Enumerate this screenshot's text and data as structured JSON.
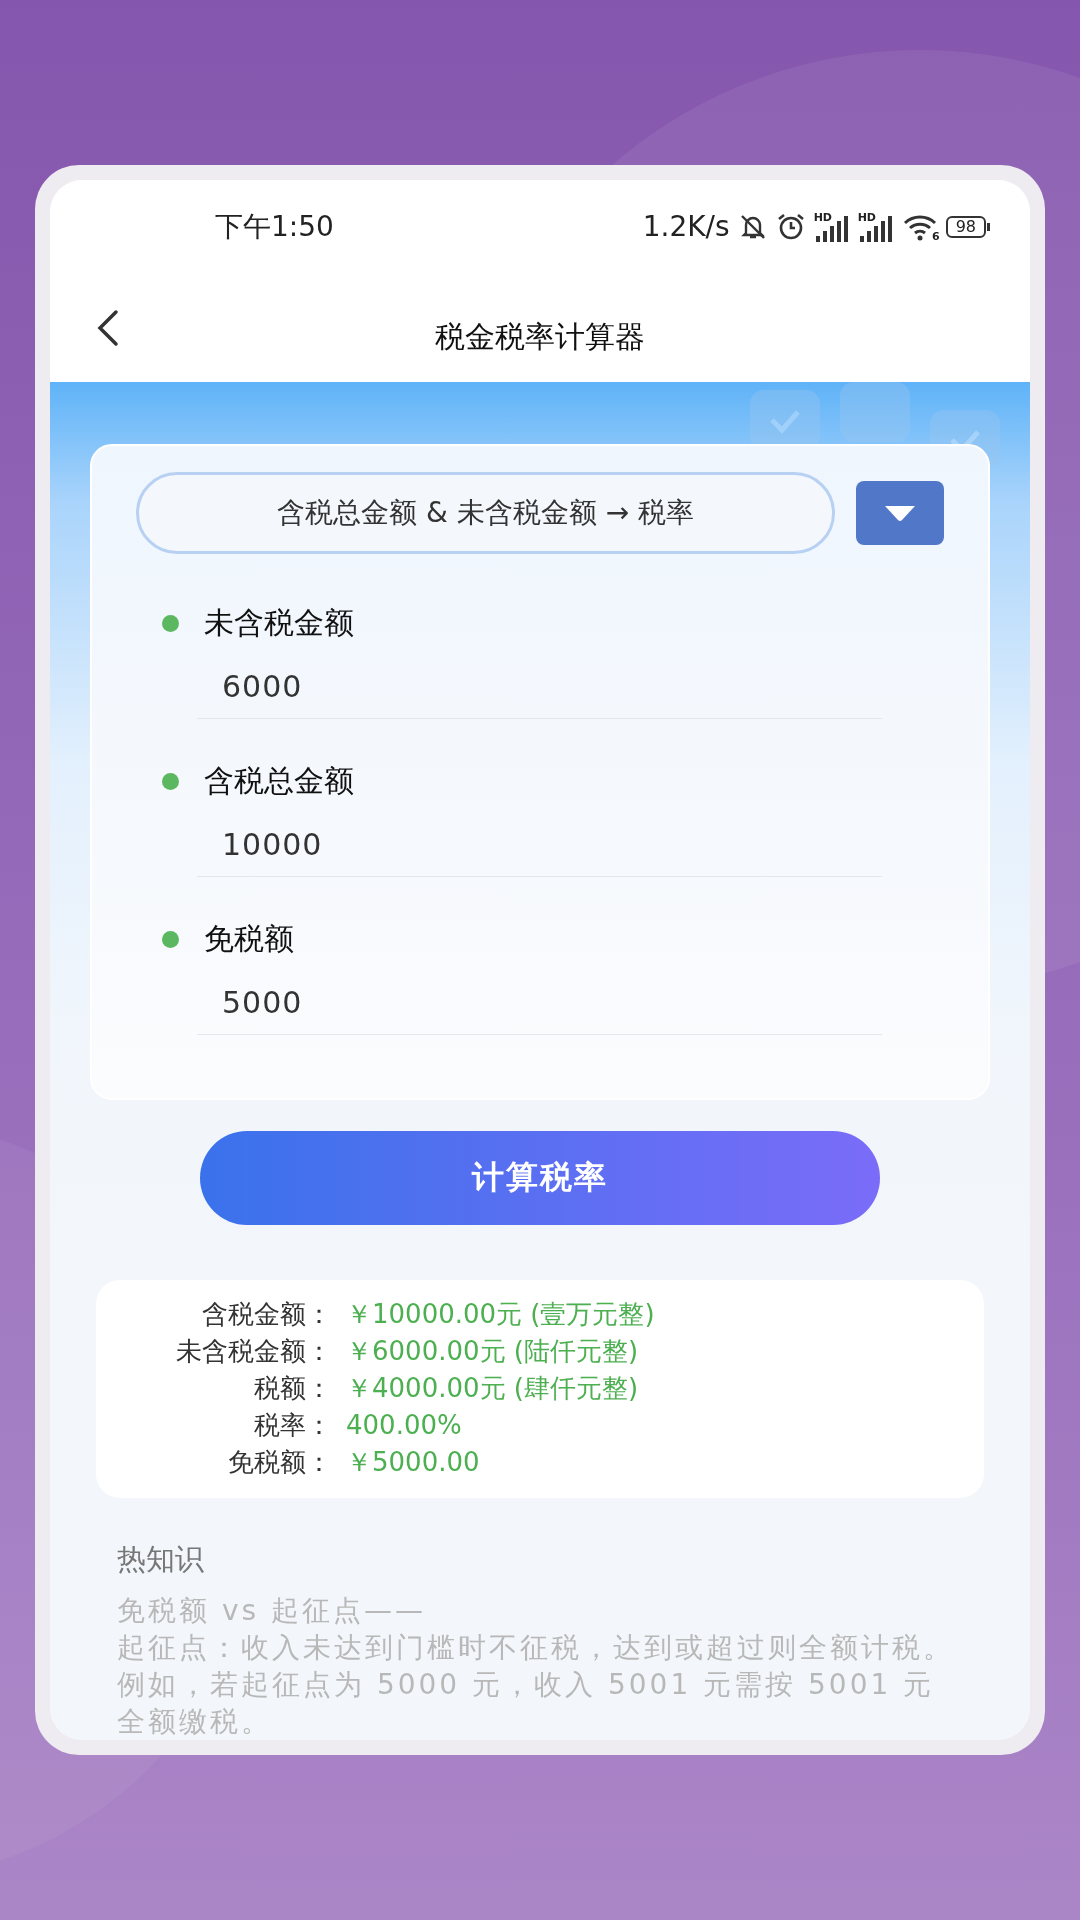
{
  "status_bar": {
    "time": "下午1:50",
    "network_speed": "1.2K/s",
    "signals": [
      {
        "label": "HD"
      },
      {
        "label": "HD"
      }
    ],
    "wifi_label": "6",
    "battery": "98"
  },
  "header": {
    "title": "税金税率计算器"
  },
  "mode_select": {
    "value": "含税总金额 & 未含税金额 → 税率"
  },
  "fields": [
    {
      "label": "未含税金额",
      "value": "6000"
    },
    {
      "label": "含税总金额",
      "value": "10000"
    },
    {
      "label": "免税额",
      "value": "5000"
    }
  ],
  "calculate_button": "计算税率",
  "results": [
    {
      "label": "含税金额：",
      "value": "￥10000.00元 (壹万元整)"
    },
    {
      "label": "未含税金额：",
      "value": "￥6000.00元 (陆仟元整)"
    },
    {
      "label": "税额：",
      "value": "￥4000.00元 (肆仟元整)"
    },
    {
      "label": "税率：",
      "value": "400.00%"
    },
    {
      "label": "免税额：",
      "value": "￥5000.00"
    }
  ],
  "tips": {
    "title": "热知识",
    "lines": [
      "免税额 vs 起征点——",
      "起征点：收入未达到门槛时不征税，达到或超过则全额计税。例如，若起征点为 5000 元，收入 5001 元需按 5001 元全额缴税。"
    ]
  }
}
